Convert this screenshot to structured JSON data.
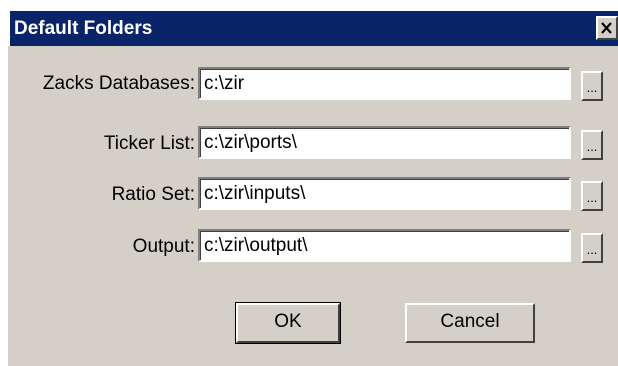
{
  "window": {
    "title": "Default Folders",
    "close_glyph": "×"
  },
  "fields": [
    {
      "label": "Zacks Databases:",
      "value": "c:\\zir",
      "browse_label": "..."
    },
    {
      "label": "Ticker List:",
      "value": "c:\\zir\\ports\\",
      "browse_label": "..."
    },
    {
      "label": "Ratio Set:",
      "value": "c:\\zir\\inputs\\",
      "browse_label": "..."
    },
    {
      "label": "Output:",
      "value": "c:\\zir\\output\\",
      "browse_label": "..."
    }
  ],
  "buttons": {
    "ok_label": "OK",
    "cancel_label": "Cancel"
  },
  "colors": {
    "titlebar": "#0a246a",
    "face": "#d4d0c8"
  }
}
